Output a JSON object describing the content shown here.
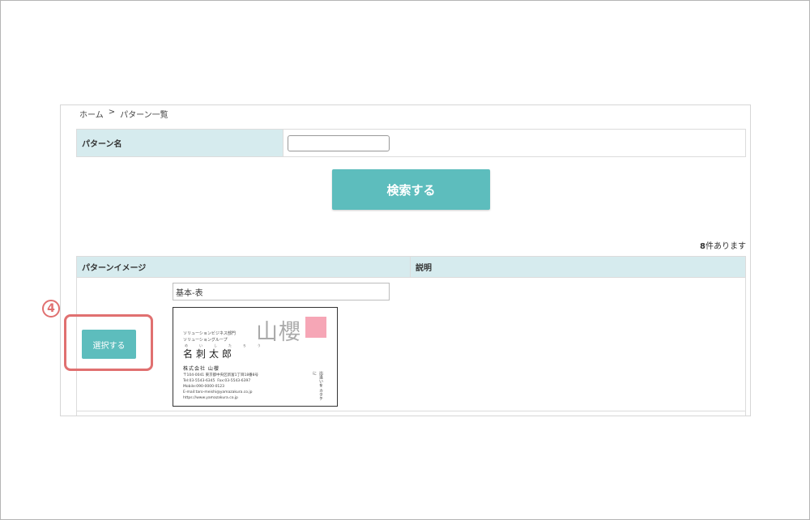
{
  "breadcrumb": {
    "home": "ホーム",
    "separator": ">",
    "current": "パターン一覧"
  },
  "search": {
    "label": "パターン名",
    "value": "",
    "button_label": "検索する"
  },
  "results": {
    "count_number": "8",
    "count_suffix": "件あります",
    "headers": {
      "image": "パターンイメージ",
      "description": "説明"
    },
    "rows": [
      {
        "pattern_name": "基本-表",
        "select_label": "選択する",
        "description": "",
        "card": {
          "logo": "山櫻",
          "dept": "ソリューションビジネス部門\nソリューショングループ",
          "kana": "めいしたろう",
          "name": "名刺太郎",
          "company": "株式会社 山櫻",
          "details": "〒104-0041 東京都中央区新富1丁目18番8号\nTel:03-5543-6345  Fax:03-5543-6397\nMobile:090-0000-0123\nE-mail:taro-meishi@yamazakura.co.jp\nhttps://www.yamazakura.co.jp",
          "vertical": "出逢いを カタチに"
        }
      }
    ]
  },
  "annotation": {
    "step": "4"
  },
  "colors": {
    "accent": "#5dbdbd",
    "header_bg": "#d6ebee",
    "highlight": "#e07070"
  }
}
